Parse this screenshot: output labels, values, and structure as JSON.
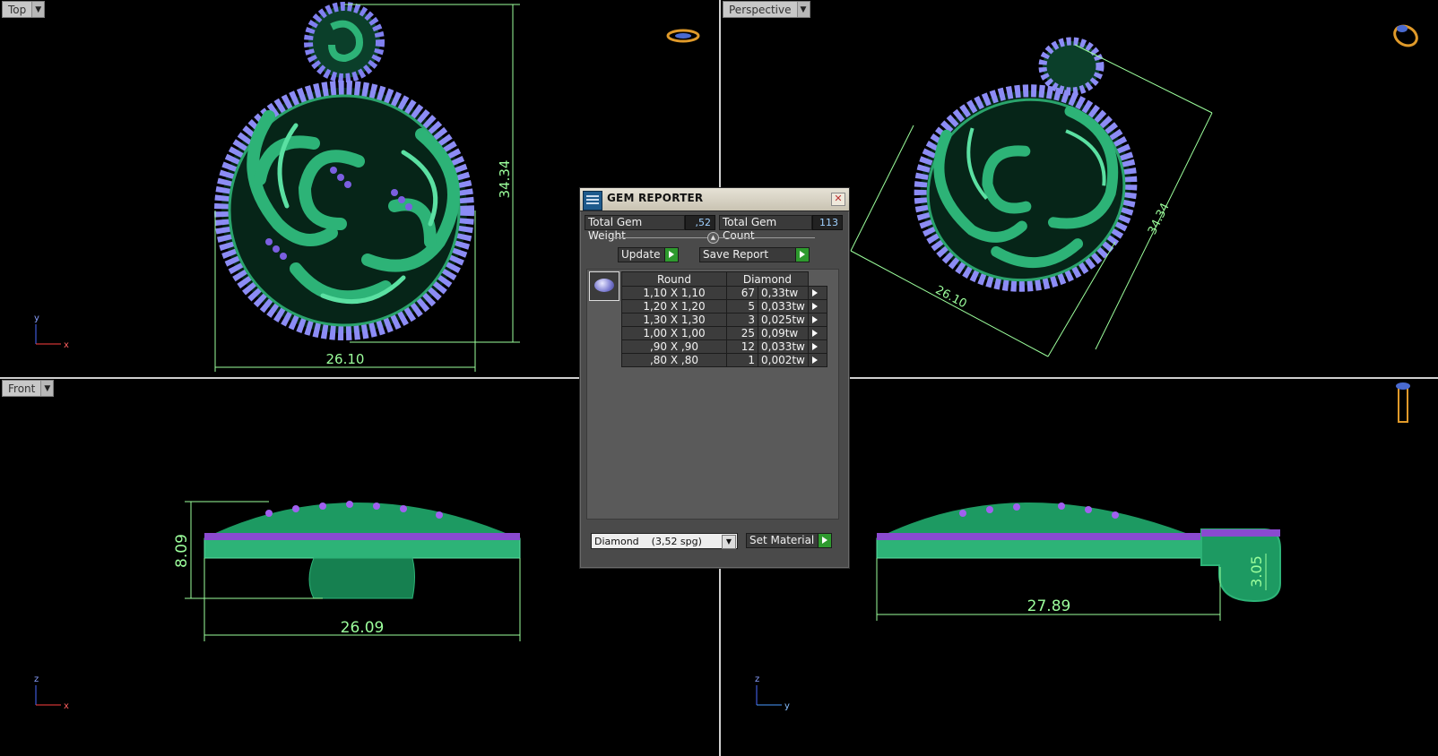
{
  "viewports": {
    "top": {
      "label": "Top",
      "dim_width": "26.10",
      "dim_height": "34.34"
    },
    "perspective": {
      "label": "Perspective",
      "dim_a": "26.10",
      "dim_b": "34.34"
    },
    "front": {
      "label": "Front",
      "dim_width": "26.09",
      "dim_height": "8.09"
    },
    "right": {
      "dim_width": "27.89",
      "dim_height": "3.05"
    }
  },
  "axes": {
    "top": {
      "v": "y",
      "h": "x"
    },
    "front": {
      "v": "z",
      "h": "x"
    },
    "right": {
      "v": "z",
      "h": "y"
    }
  },
  "gem_reporter": {
    "title": "GEM REPORTER",
    "total_weight_label": "Total Gem Weight",
    "total_weight_value": ",52",
    "total_count_label": "Total Gem Count",
    "total_count_value": "113",
    "update_label": "Update",
    "save_report_label": "Save Report",
    "table": {
      "col_shape": "Round",
      "col_material": "Diamond",
      "rows": [
        {
          "size": "1,10 X 1,10",
          "count": "67",
          "weight": "0,33tw"
        },
        {
          "size": "1,20 X 1,20",
          "count": "5",
          "weight": "0,033tw"
        },
        {
          "size": "1,30 X 1,30",
          "count": "3",
          "weight": "0,025tw"
        },
        {
          "size": "1,00 X 1,00",
          "count": "25",
          "weight": "0,09tw"
        },
        {
          "size": ",90 X ,90",
          "count": "12",
          "weight": "0,033tw"
        },
        {
          "size": ",80 X ,80",
          "count": "1",
          "weight": "0,002tw"
        }
      ]
    },
    "material_select": "Diamond    (3,52 spg)",
    "set_material_label": "Set Material"
  },
  "colors": {
    "metal": "#2db377",
    "gem": "#8f8fff",
    "dimension": "#9cff9c"
  }
}
